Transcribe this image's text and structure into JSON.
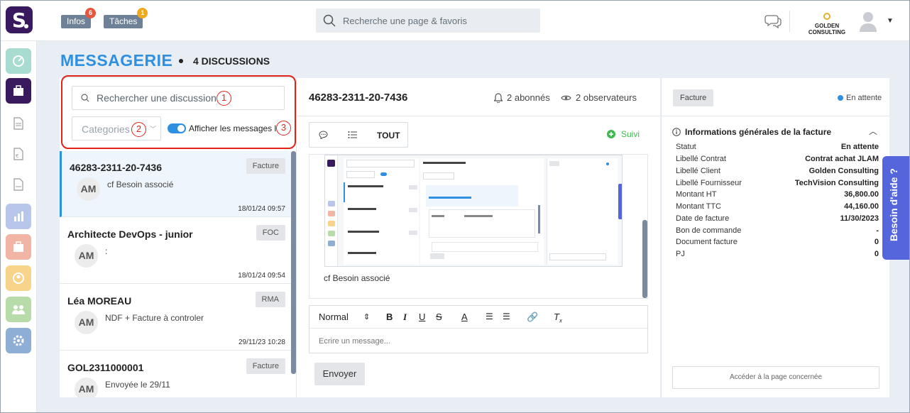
{
  "topbar": {
    "infos_label": "Infos",
    "infos_badge": "6",
    "taches_label": "Tâches",
    "taches_badge": "1",
    "search_placeholder": "Recherche une page & favoris",
    "company": "GOLDEN CONSULTING"
  },
  "header": {
    "title": "MESSAGERIE",
    "count": "4 DISCUSSIONS"
  },
  "filters": {
    "search_placeholder": "Rechercher une discussion",
    "category_placeholder": "Categories",
    "toggle_label": "Afficher les messages lus",
    "callouts": [
      "1",
      "2",
      "3"
    ]
  },
  "discussions": [
    {
      "title": "46283-2311-20-7436",
      "tag": "Facture",
      "avatar": "AM",
      "message": "cf Besoin associé",
      "date": "18/01/24 09:57"
    },
    {
      "title": "Architecte DevOps - junior",
      "tag": "FOC",
      "avatar": "AM",
      "message": ":",
      "date": "18/01/24 09:54"
    },
    {
      "title": "Léa MOREAU",
      "tag": "RMA",
      "avatar": "AM",
      "message": "NDF + Facture à controler",
      "date": "29/11/23 10:28"
    },
    {
      "title": "GOL2311000001",
      "tag": "Facture",
      "avatar": "AM",
      "message": "Envoyée le 29/11",
      "date": ""
    }
  ],
  "conversation": {
    "title": "46283-2311-20-7436",
    "subscribers": "2 abonnés",
    "observers": "2 observateurs",
    "tab_all": "TOUT",
    "follow": "Suivi",
    "message_caption": "cf Besoin associé",
    "editor": {
      "format": "Normal",
      "placeholder": "Ecrire un message..."
    },
    "send": "Envoyer"
  },
  "details": {
    "tag": "Facture",
    "status": "En attente",
    "section_title": "Informations générales de la facture",
    "rows": [
      {
        "k": "Statut",
        "v": "En attente"
      },
      {
        "k": "Libellé Contrat",
        "v": "Contrat achat JLAM"
      },
      {
        "k": "Libellé Client",
        "v": "Golden Consulting"
      },
      {
        "k": "Libellé Fournisseur",
        "v": "TechVision Consulting"
      },
      {
        "k": "Montant HT",
        "v": "36,800.00"
      },
      {
        "k": "Montant TTC",
        "v": "44,160.00"
      },
      {
        "k": "Date de facture",
        "v": "11/30/2023"
      },
      {
        "k": "Bon de commande",
        "v": "-"
      },
      {
        "k": "Document facture",
        "v": "0"
      },
      {
        "k": "PJ",
        "v": "0"
      }
    ],
    "access_button": "Accéder à la page concernée"
  },
  "help": "Besoin d'aide ?",
  "colors": {
    "accent": "#2f8fe0",
    "callout_red": "#e2231a",
    "brand": "#3a1a5e",
    "help_tab": "#5566dd"
  }
}
